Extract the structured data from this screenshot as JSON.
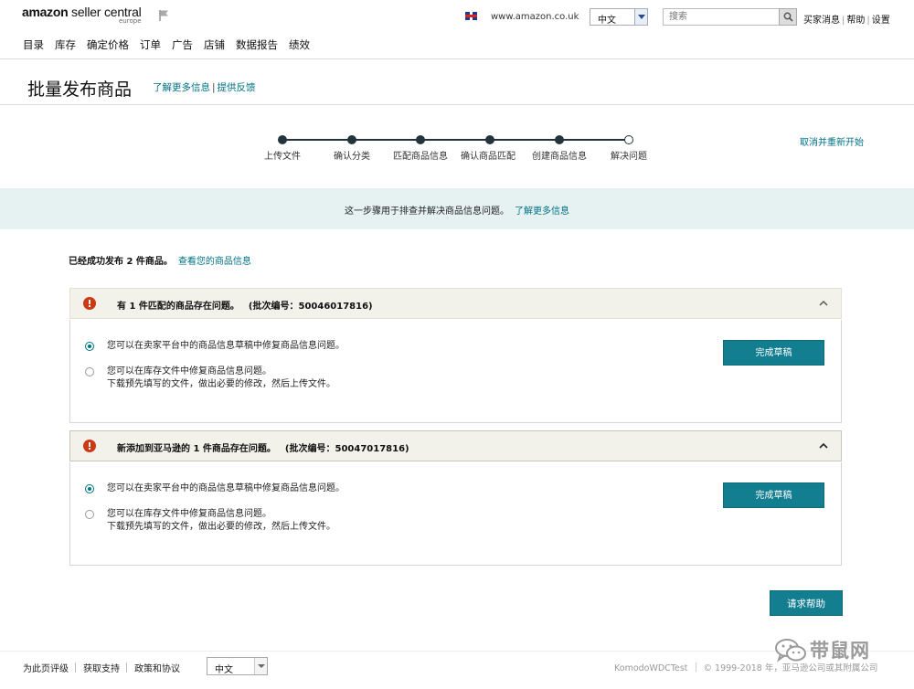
{
  "header": {
    "logo_main_bold": "amazon",
    "logo_main": " seller central",
    "logo_sub": "europe",
    "site_url": "www.amazon.co.uk",
    "language": "中文",
    "search_placeholder": "搜索",
    "top_links": [
      "买家消息",
      "帮助",
      "设置"
    ]
  },
  "nav": {
    "items": [
      "目录",
      "库存",
      "确定价格",
      "订单",
      "广告",
      "店铺",
      "数据报告",
      "绩效"
    ]
  },
  "page": {
    "title": "批量发布商品",
    "learn_more": "了解更多信息",
    "separator": "|",
    "feedback": "提供反馈"
  },
  "stepper": {
    "steps": [
      "上传文件",
      "确认分类",
      "匹配商品信息",
      "确认商品匹配",
      "创建商品信息",
      "解决问题"
    ],
    "current_step": 6,
    "restart_link": "取消并重新开始"
  },
  "info": {
    "text": "这一步骤用于排查并解决商品信息问题。",
    "link": "了解更多信息"
  },
  "success": {
    "text": "已经成功发布 2 件商品。",
    "link": "查看您的商品信息"
  },
  "issues": [
    {
      "title": "有 1 件匹配的商品存在问题。",
      "batch": "(批次编号：50046017816)",
      "option1": "您可以在卖家平台中的商品信息草稿中修复商品信息问题。",
      "option2_line1": "您可以在库存文件中修复商品信息问题。",
      "option2_line2": "下载预先填写的文件，做出必要的修改，然后上传文件。",
      "button": "完成草稿"
    },
    {
      "title": "新添加到亚马逊的 1 件商品存在问题。",
      "batch": "(批次编号：50047017816)",
      "option1": "您可以在卖家平台中的商品信息草稿中修复商品信息问题。",
      "option2_line1": "您可以在库存文件中修复商品信息问题。",
      "option2_line2": "下载预先填写的文件，做出必要的修改，然后上传文件。",
      "button": "完成草稿"
    }
  ],
  "help_button": "请求帮助",
  "footer": {
    "links": [
      "为此页评级",
      "获取支持",
      "政策和协议"
    ],
    "language": "中文",
    "account": "KomodoWDCTest",
    "copyright": "© 1999-2018 年，亚马逊公司或其附属公司"
  },
  "watermark": {
    "text": "带鼠网"
  },
  "colors": {
    "accent": "#127e8f",
    "link": "#007185",
    "alert": "#cc3a14",
    "info_band": "#e6f2f2",
    "issue_header": "#f3f2ea"
  }
}
